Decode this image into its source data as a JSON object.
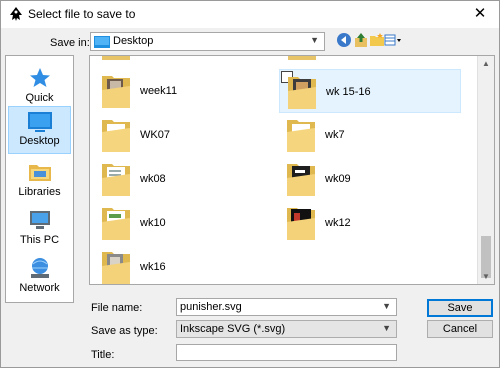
{
  "window": {
    "title": "Select file to save to",
    "close_glyph": "✕"
  },
  "save_in": {
    "label": "Save in:",
    "value": "Desktop"
  },
  "places": [
    {
      "label": "Quick access",
      "icon": "star-icon"
    },
    {
      "label": "Desktop",
      "icon": "desktop-icon",
      "selected": true
    },
    {
      "label": "Libraries",
      "icon": "libraries-icon"
    },
    {
      "label": "This PC",
      "icon": "computer-icon"
    },
    {
      "label": "Network",
      "icon": "network-icon"
    }
  ],
  "files": [
    {
      "name": "week11",
      "kind": "photos"
    },
    {
      "name": "wk 15-16",
      "kind": "photos"
    },
    {
      "name": "WK07",
      "kind": "plain"
    },
    {
      "name": "wk7",
      "kind": "plain"
    },
    {
      "name": "wk08",
      "kind": "docs"
    },
    {
      "name": "wk09",
      "kind": "dark"
    },
    {
      "name": "wk10",
      "kind": "docs"
    },
    {
      "name": "wk12",
      "kind": "dark"
    },
    {
      "name": "wk16",
      "kind": "photos"
    }
  ],
  "form": {
    "file_name_label": "File name:",
    "file_name_value": "punisher.svg",
    "save_type_label": "Save as type:",
    "save_type_value": "Inkscape SVG (*.svg)",
    "title_label": "Title:",
    "title_value": ""
  },
  "buttons": {
    "save": "Save",
    "cancel": "Cancel"
  }
}
